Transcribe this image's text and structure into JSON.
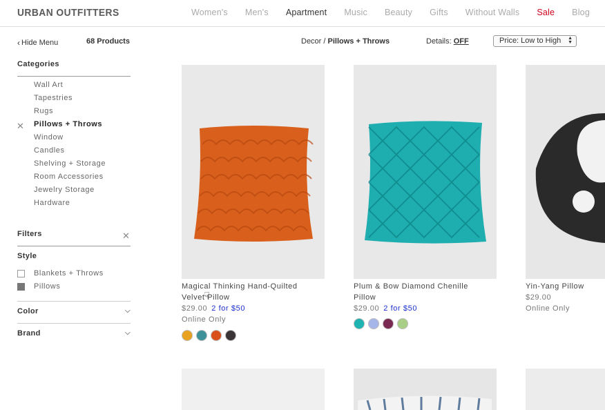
{
  "header": {
    "logo": "URBAN OUTFITTERS",
    "nav": [
      {
        "label": "Women's",
        "state": "normal"
      },
      {
        "label": "Men's",
        "state": "normal"
      },
      {
        "label": "Apartment",
        "state": "active"
      },
      {
        "label": "Music",
        "state": "normal"
      },
      {
        "label": "Beauty",
        "state": "normal"
      },
      {
        "label": "Gifts",
        "state": "normal"
      },
      {
        "label": "Without Walls",
        "state": "normal"
      },
      {
        "label": "Sale",
        "state": "sale"
      },
      {
        "label": "Blog",
        "state": "normal"
      }
    ]
  },
  "toolbar": {
    "hide_menu": "Hide Menu",
    "product_count": "68 Products",
    "breadcrumb_root": "Decor /",
    "breadcrumb_current": "Pillows + Throws",
    "details_label": "Details:",
    "details_value": "OFF",
    "sort_value": "Price: Low to High"
  },
  "sidebar": {
    "categories_title": "Categories",
    "categories": [
      {
        "label": "Wall Art",
        "selected": false
      },
      {
        "label": "Tapestries",
        "selected": false
      },
      {
        "label": "Rugs",
        "selected": false
      },
      {
        "label": "Pillows + Throws",
        "selected": true
      },
      {
        "label": "Window",
        "selected": false
      },
      {
        "label": "Candles",
        "selected": false
      },
      {
        "label": "Shelving + Storage",
        "selected": false
      },
      {
        "label": "Room Accessories",
        "selected": false
      },
      {
        "label": "Jewelry Storage",
        "selected": false
      },
      {
        "label": "Hardware",
        "selected": false
      }
    ],
    "filters_title": "Filters",
    "style_title": "Style",
    "style_options": [
      {
        "label": "Blankets + Throws",
        "checked": false
      },
      {
        "label": "Pillows",
        "checked": true
      }
    ],
    "color_title": "Color",
    "brand_title": "Brand"
  },
  "products": [
    {
      "name_line1": "Magical Thinking Hand-Quilted",
      "name_line2": "Velvet Pillow",
      "price": "$29.00",
      "deal": "2 for $50",
      "availability": "Online Only",
      "swatches": [
        "#e8a21f",
        "#3f9199",
        "#d9501a",
        "#3c3538"
      ]
    },
    {
      "name_line1": "Plum & Bow Diamond Chenille",
      "name_line2": "Pillow",
      "price": "$29.00",
      "deal": "2 for $50",
      "availability": "",
      "swatches": [
        "#1fb3b1",
        "#a7b6e8",
        "#7a2a52",
        "#a9cf86"
      ]
    },
    {
      "name_line1": "Yin-Yang Pillow",
      "name_line2": "",
      "price": "$29.00",
      "deal": "",
      "availability": "Online Only",
      "swatches": []
    }
  ]
}
